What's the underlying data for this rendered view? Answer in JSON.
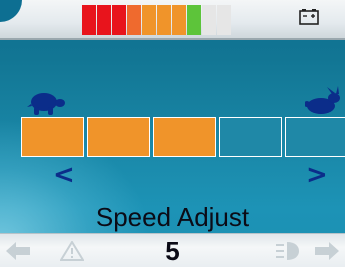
{
  "status_bar": {
    "battery_level": 7,
    "battery_segments": 10,
    "segment_colors": [
      "#e8141c",
      "#e8141c",
      "#e8141c",
      "#ef6a2e",
      "#f0942a",
      "#f0942a",
      "#f0942a",
      "#5dc43a",
      "#e6e6e6",
      "#e6e6e6"
    ],
    "battery_icon": "battery-charge-icon"
  },
  "speed": {
    "min_icon": "turtle-icon",
    "max_icon": "rabbit-icon",
    "level": 3,
    "total": 5,
    "active_color": "#f0942a",
    "inactive_color": "#1f88a7",
    "decrease_label": "<",
    "increase_label": ">"
  },
  "title": "Speed Adjust",
  "footer": {
    "page_number": "5",
    "icons": [
      "left-arrow-icon",
      "warning-triangle-icon",
      "light-icon",
      "right-arrow-icon"
    ]
  }
}
